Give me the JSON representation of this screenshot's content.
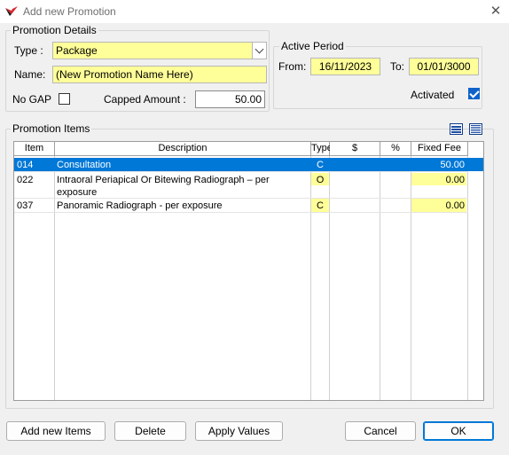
{
  "window": {
    "title": "Add new Promotion",
    "close_glyph": "✕"
  },
  "details": {
    "group_label": "Promotion Details",
    "type_label": "Type :",
    "type_value": "Package",
    "name_label": "Name:",
    "name_value": "(New Promotion Name Here)",
    "nogap_label": "No GAP",
    "nogap_checked": false,
    "capped_label": "Capped Amount :",
    "capped_value": "50.00"
  },
  "period": {
    "group_label": "Active Period",
    "from_label": "From:",
    "from_value": "16/11/2023",
    "to_label": "To:",
    "to_value": "01/01/3000",
    "activated_label": "Activated",
    "activated_checked": true
  },
  "items": {
    "group_label": "Promotion Items",
    "columns": [
      "Item",
      "Description",
      "Type",
      "$",
      "%",
      "Fixed Fee"
    ],
    "rows": [
      {
        "item": "014",
        "description": "Consultation",
        "description2": "",
        "type": "C",
        "dollar": "",
        "percent": "",
        "fixed_fee": "50.00",
        "selected": true
      },
      {
        "item": "022",
        "description": "Intraoral Periapical Or Bitewing Radiograph – per",
        "description2": "exposure",
        "type": "O",
        "dollar": "",
        "percent": "",
        "fixed_fee": "0.00",
        "selected": false
      },
      {
        "item": "037",
        "description": "Panoramic Radiograph - per exposure",
        "description2": "",
        "type": "C",
        "dollar": "",
        "percent": "",
        "fixed_fee": "0.00",
        "selected": false
      }
    ]
  },
  "buttons": {
    "add_new_items": "Add new Items",
    "delete": "Delete",
    "apply_values": "Apply Values",
    "cancel": "Cancel",
    "ok": "OK"
  },
  "colors": {
    "accent": "#0078d7",
    "field_yellow": "#ffff99",
    "selection": "#0078d7"
  }
}
